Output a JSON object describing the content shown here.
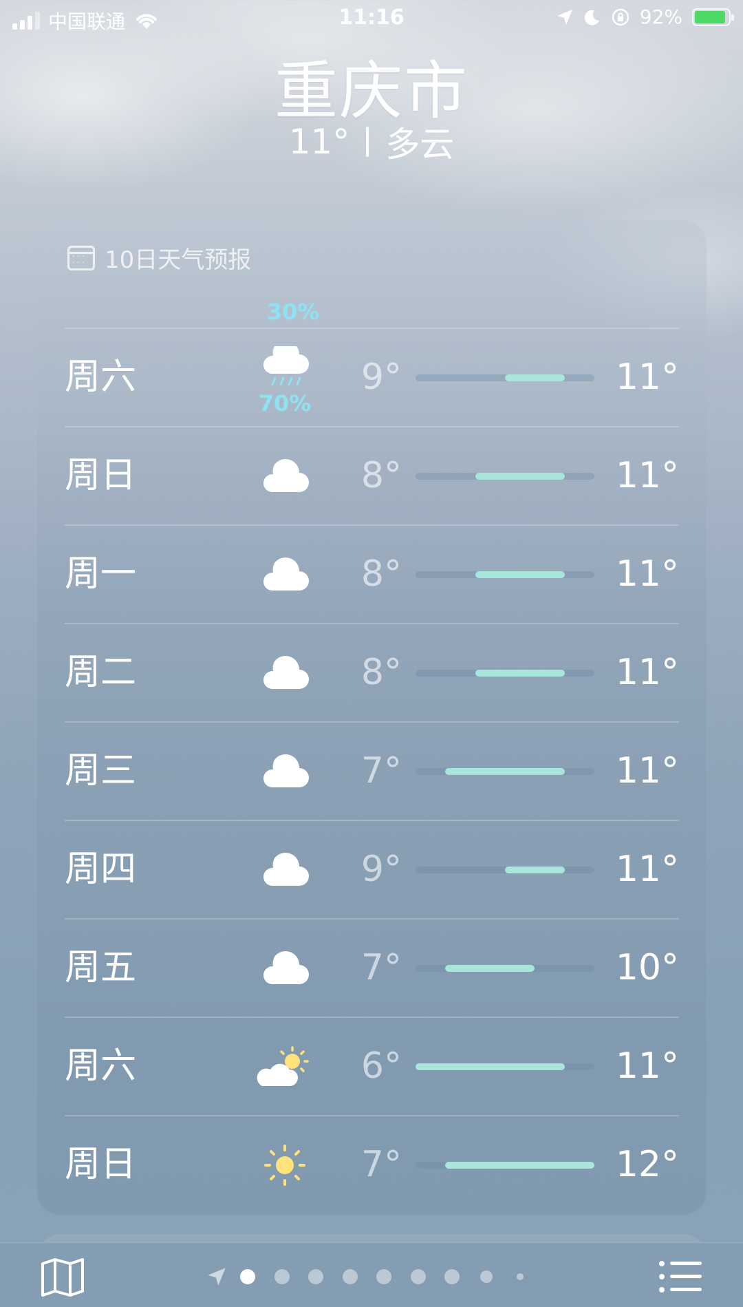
{
  "status_bar": {
    "carrier": "中国联通",
    "time": "11:16",
    "battery": "92%",
    "battery_level": 0.92
  },
  "header": {
    "city": "重庆市",
    "temperature": "11°",
    "condition": "多云"
  },
  "forecast": {
    "title": "10日天气预报",
    "partial_row": {
      "precip": "30%"
    },
    "range": {
      "min": 6,
      "max": 12
    },
    "days": [
      {
        "day": "周六",
        "icon": "rain-cloud-icon",
        "precip": "70%",
        "low": "9°",
        "high": "11°",
        "low_val": 9,
        "high_val": 11
      },
      {
        "day": "周日",
        "icon": "cloud-icon",
        "precip": "",
        "low": "8°",
        "high": "11°",
        "low_val": 8,
        "high_val": 11
      },
      {
        "day": "周一",
        "icon": "cloud-icon",
        "precip": "",
        "low": "8°",
        "high": "11°",
        "low_val": 8,
        "high_val": 11
      },
      {
        "day": "周二",
        "icon": "cloud-icon",
        "precip": "",
        "low": "8°",
        "high": "11°",
        "low_val": 8,
        "high_val": 11
      },
      {
        "day": "周三",
        "icon": "cloud-icon",
        "precip": "",
        "low": "7°",
        "high": "11°",
        "low_val": 7,
        "high_val": 11
      },
      {
        "day": "周四",
        "icon": "cloud-icon",
        "precip": "",
        "low": "9°",
        "high": "11°",
        "low_val": 9,
        "high_val": 11
      },
      {
        "day": "周五",
        "icon": "cloud-icon",
        "precip": "",
        "low": "7°",
        "high": "10°",
        "low_val": 7,
        "high_val": 10
      },
      {
        "day": "周六",
        "icon": "partly-sunny-icon",
        "precip": "",
        "low": "6°",
        "high": "11°",
        "low_val": 6,
        "high_val": 11
      },
      {
        "day": "周日",
        "icon": "sun-icon",
        "precip": "",
        "low": "7°",
        "high": "12°",
        "low_val": 7,
        "high_val": 12
      }
    ]
  },
  "bottom_bar": {
    "page_count": 9,
    "active_page": 0
  },
  "colors": {
    "precip": "#8fe1f4",
    "bar": "#a8e6dc",
    "sun": "#ffe27a"
  }
}
